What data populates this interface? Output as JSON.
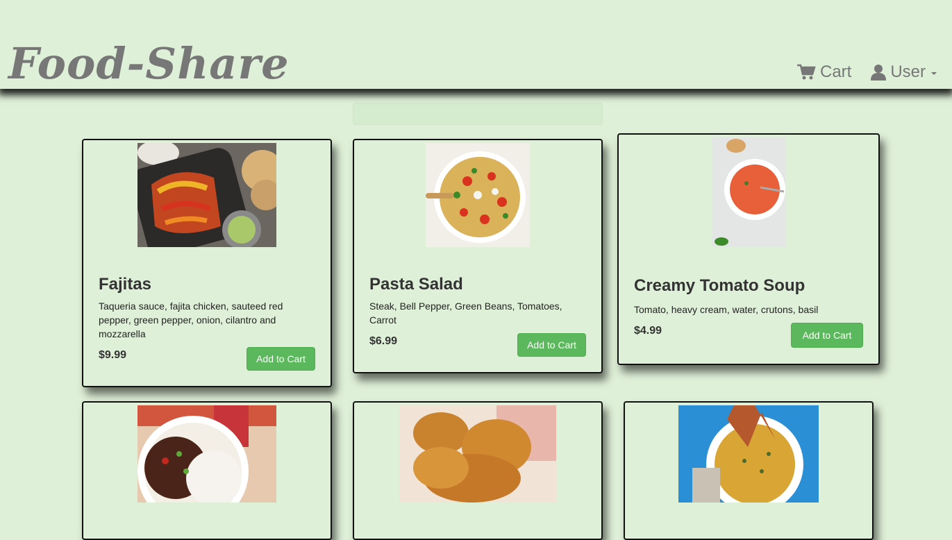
{
  "brand": "Food-Share",
  "nav": {
    "cart_label": "Cart",
    "user_label": "User"
  },
  "products": [
    {
      "title": "Fajitas",
      "description": "Taqueria sauce, fajita chicken, sauteed red pepper, green pepper, onion, cilantro and mozzarella",
      "price": "$9.99",
      "button": "Add to Cart",
      "image": "fajitas-photo"
    },
    {
      "title": "Pasta Salad",
      "description": "Steak, Bell Pepper, Green Beans, Tomatoes, Carrot",
      "price": "$6.99",
      "button": "Add to Cart",
      "image": "pasta-salad-photo"
    },
    {
      "title": "Creamy Tomato Soup",
      "description": "Tomato, heavy cream, water, crutons, basil",
      "price": "$4.99",
      "button": "Add to Cart",
      "image": "tomato-soup-photo"
    },
    {
      "image": "rice-bowl-photo"
    },
    {
      "image": "fried-chicken-photo"
    },
    {
      "image": "soup-bread-photo"
    }
  ],
  "colors": {
    "background": "#dff0d8",
    "button": "#5cb85c",
    "brand_text": "#777777"
  }
}
